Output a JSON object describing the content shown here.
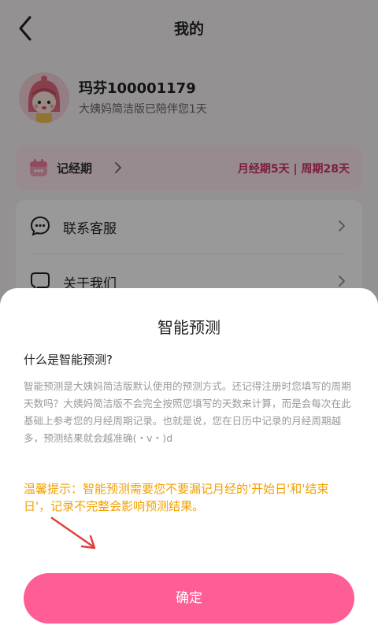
{
  "header": {
    "title": "我的"
  },
  "profile": {
    "name": "玛芬100001179",
    "subtitle": "大姨妈简洁版已陪伴您1天"
  },
  "period_card": {
    "label": "记经期",
    "summary": "月经期5天 | 周期28天"
  },
  "menu": [
    {
      "label": "联系客服",
      "icon": "chat-bubble-icon"
    },
    {
      "label": "关于我们",
      "icon": "info-bubble-icon"
    }
  ],
  "modal": {
    "title": "智能预测",
    "question": "什么是智能预测?",
    "body": "智能预测是大姨妈简洁版默认使用的预测方式。还记得注册时您填写的周期天数吗？大姨妈简洁版不会完全按照您填写的天数来计算，而是会每次在此基础上参考您的月经周期记录。也就是说，您在日历中记录的月经周期越多，预测结果就会越准确(・v・)d",
    "tip": "温馨提示：智能预测需要您不要漏记月经的'开始日'和'结束日'，记录不完整会影响预测结果。",
    "confirm_label": "确定"
  },
  "colors": {
    "accent": "#ff5d95",
    "tip": "#f2a000",
    "period_summary": "#d0306a",
    "annotation_arrow": "#e0413a"
  }
}
